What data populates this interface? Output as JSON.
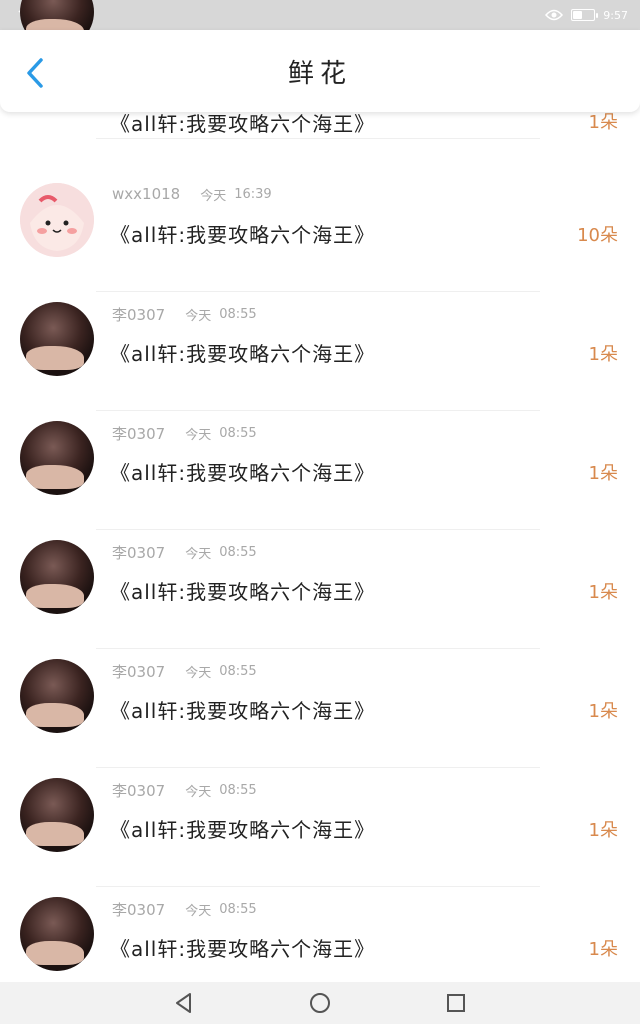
{
  "status_bar": {
    "time": "9:57",
    "battery_level": 0.45
  },
  "header": {
    "title": "鲜花"
  },
  "colors": {
    "accent": "#2a9ae6",
    "flower": "#d8894d",
    "meta": "#a8a8a8"
  },
  "rows": [
    {
      "user": "",
      "day": "",
      "time": "",
      "book": "《all轩:我要攻略六个海王》",
      "count": "1朵",
      "avatar": "dark"
    },
    {
      "user": "wxx1018",
      "day": "今天",
      "time": "16:39",
      "book": "《all轩:我要攻略六个海王》",
      "count": "10朵",
      "avatar": "pink"
    },
    {
      "user": "李0307",
      "day": "今天",
      "time": "08:55",
      "book": "《all轩:我要攻略六个海王》",
      "count": "1朵",
      "avatar": "dark"
    },
    {
      "user": "李0307",
      "day": "今天",
      "time": "08:55",
      "book": "《all轩:我要攻略六个海王》",
      "count": "1朵",
      "avatar": "dark"
    },
    {
      "user": "李0307",
      "day": "今天",
      "time": "08:55",
      "book": "《all轩:我要攻略六个海王》",
      "count": "1朵",
      "avatar": "dark"
    },
    {
      "user": "李0307",
      "day": "今天",
      "time": "08:55",
      "book": "《all轩:我要攻略六个海王》",
      "count": "1朵",
      "avatar": "dark"
    },
    {
      "user": "李0307",
      "day": "今天",
      "time": "08:55",
      "book": "《all轩:我要攻略六个海王》",
      "count": "1朵",
      "avatar": "dark"
    },
    {
      "user": "李0307",
      "day": "今天",
      "time": "08:55",
      "book": "《all轩:我要攻略六个海王》",
      "count": "1朵",
      "avatar": "dark"
    }
  ]
}
